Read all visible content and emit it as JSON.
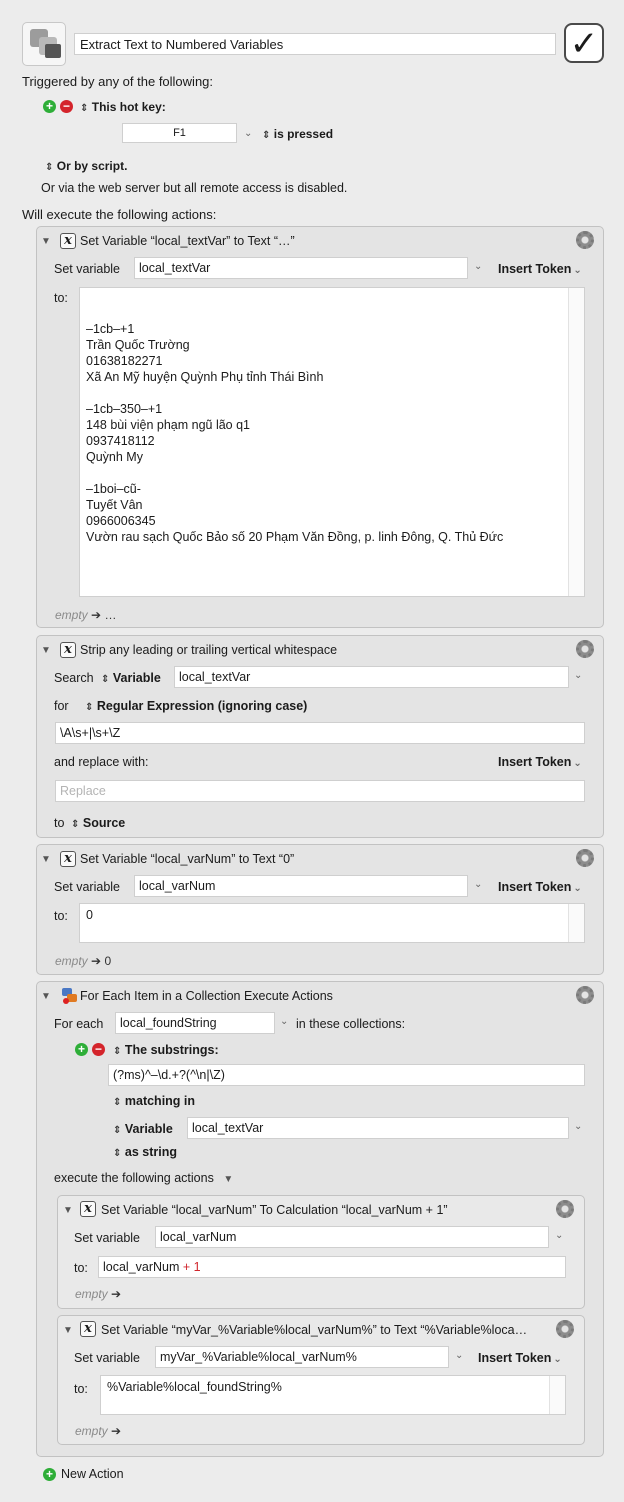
{
  "macro": {
    "title": "Extract Text to Numbered Variables",
    "enabled_mark": "✓"
  },
  "triggers": {
    "heading": "Triggered by any of the following:",
    "hotkey_label": "This hot key:",
    "hotkey_value": "F1",
    "hotkey_state": "is pressed",
    "or_script": "Or by script.",
    "web_server": "Or via the web server but all remote access is disabled."
  },
  "actions_heading": "Will execute the following actions:",
  "action1": {
    "title": "Set Variable “local_textVar” to Text “…”",
    "set_variable_label": "Set variable",
    "variable": "local_textVar",
    "insert_token": "Insert Token",
    "to_label": "to:",
    "text_lines": [
      "–1cb–+1",
      "Trần Quốc Trường",
      "01638182271",
      "Xã An Mỹ huyện Quỳnh Phụ tỉnh Thái Bình",
      "",
      "–1cb–350–+1",
      "148 bùi viện phạm ngũ lão q1",
      "0937418112",
      "Quỳnh My",
      "",
      "–1boi–cũ-",
      "Tuyết Vân",
      "0966006345",
      "Vườn rau sạch Quốc Bảo số 20 Phạm Văn Đồng, p. linh Đông, Q. Thủ Đức"
    ],
    "footer_empty": "empty",
    "footer_value": "…"
  },
  "action2": {
    "title": "Strip any leading or trailing vertical whitespace",
    "search_label": "Search",
    "search_type": "Variable",
    "variable": "local_textVar",
    "for_label": "for",
    "for_type": "Regular Expression (ignoring case)",
    "regex": "\\A\\s+|\\s+\\Z",
    "replace_label": "and replace with:",
    "insert_token": "Insert Token",
    "replace_placeholder": "Replace",
    "to_label": "to",
    "to_value": "Source"
  },
  "action3": {
    "title": "Set Variable “local_varNum” to Text “0”",
    "set_variable_label": "Set variable",
    "variable": "local_varNum",
    "insert_token": "Insert Token",
    "to_label": "to:",
    "text": "0",
    "footer_empty": "empty",
    "footer_value": "0"
  },
  "action4": {
    "title": "For Each Item in a Collection Execute Actions",
    "for_each_label": "For each",
    "variable": "local_foundString",
    "collections_label": "in these collections:",
    "substrings_label": "The substrings:",
    "regex": "(?ms)^–\\d.+?(^\\n|\\Z)",
    "matching_in": "matching in",
    "variable_type": "Variable",
    "source_variable": "local_textVar",
    "as_string": "as string",
    "execute_label": "execute the following actions",
    "sub1": {
      "title": "Set Variable “local_varNum” To Calculation “local_varNum + 1”",
      "set_variable_label": "Set variable",
      "variable": "local_varNum",
      "to_label": "to:",
      "calc_left": "local_varNum",
      "calc_op": " + 1",
      "footer_empty": "empty"
    },
    "sub2": {
      "title": "Set Variable “myVar_%Variable%local_varNum%” to Text “%Variable%loca…",
      "set_variable_label": "Set variable",
      "variable": "myVar_%Variable%local_varNum%",
      "insert_token": "Insert Token",
      "to_label": "to:",
      "text": "%Variable%local_foundString%",
      "footer_empty": "empty"
    }
  },
  "new_action": "New Action"
}
